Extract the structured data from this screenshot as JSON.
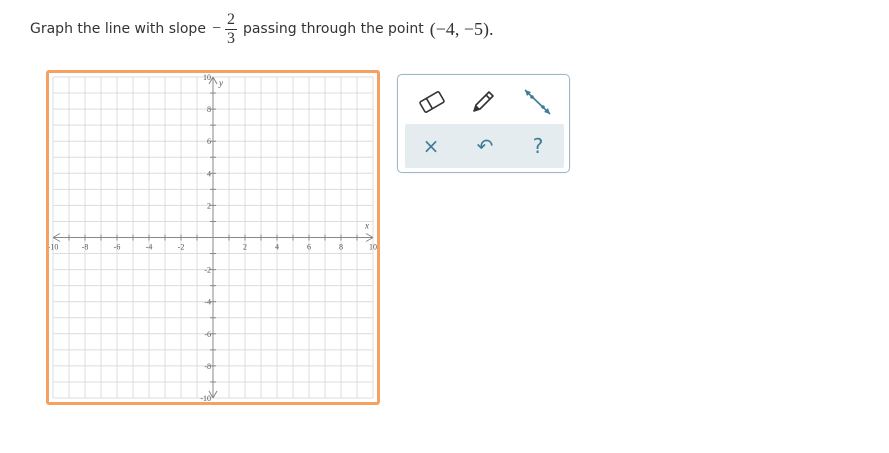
{
  "prompt": {
    "lead": "Graph the line with slope",
    "minus": "−",
    "numerator": "2",
    "denominator": "3",
    "middle": "passing through the point",
    "point": "(−4, −5)."
  },
  "graph": {
    "x_axis_label": "x",
    "y_axis_label": "y",
    "x_tick_labels": [
      "-10",
      "-8",
      "-6",
      "-4",
      "-2",
      "2",
      "4",
      "6",
      "8",
      "10"
    ],
    "y_tick_labels": [
      "10",
      "8",
      "6",
      "4",
      "2",
      "-2",
      "-4",
      "-6",
      "-8",
      "-10"
    ],
    "x_range": [
      -10,
      10
    ],
    "y_range": [
      -10,
      10
    ],
    "grid": true,
    "border_color": "#f5a162",
    "grid_color": "#dcdcdc",
    "axis_color": "#888888"
  },
  "toolbar": {
    "tools": [
      {
        "name": "eraser-icon"
      },
      {
        "name": "pencil-icon"
      },
      {
        "name": "line-segment-icon"
      }
    ],
    "actions": [
      {
        "name": "clear-button",
        "glyph": "×"
      },
      {
        "name": "undo-button",
        "glyph": "↶"
      },
      {
        "name": "help-button",
        "glyph": "?"
      }
    ],
    "accent_color": "#3f7d96"
  }
}
